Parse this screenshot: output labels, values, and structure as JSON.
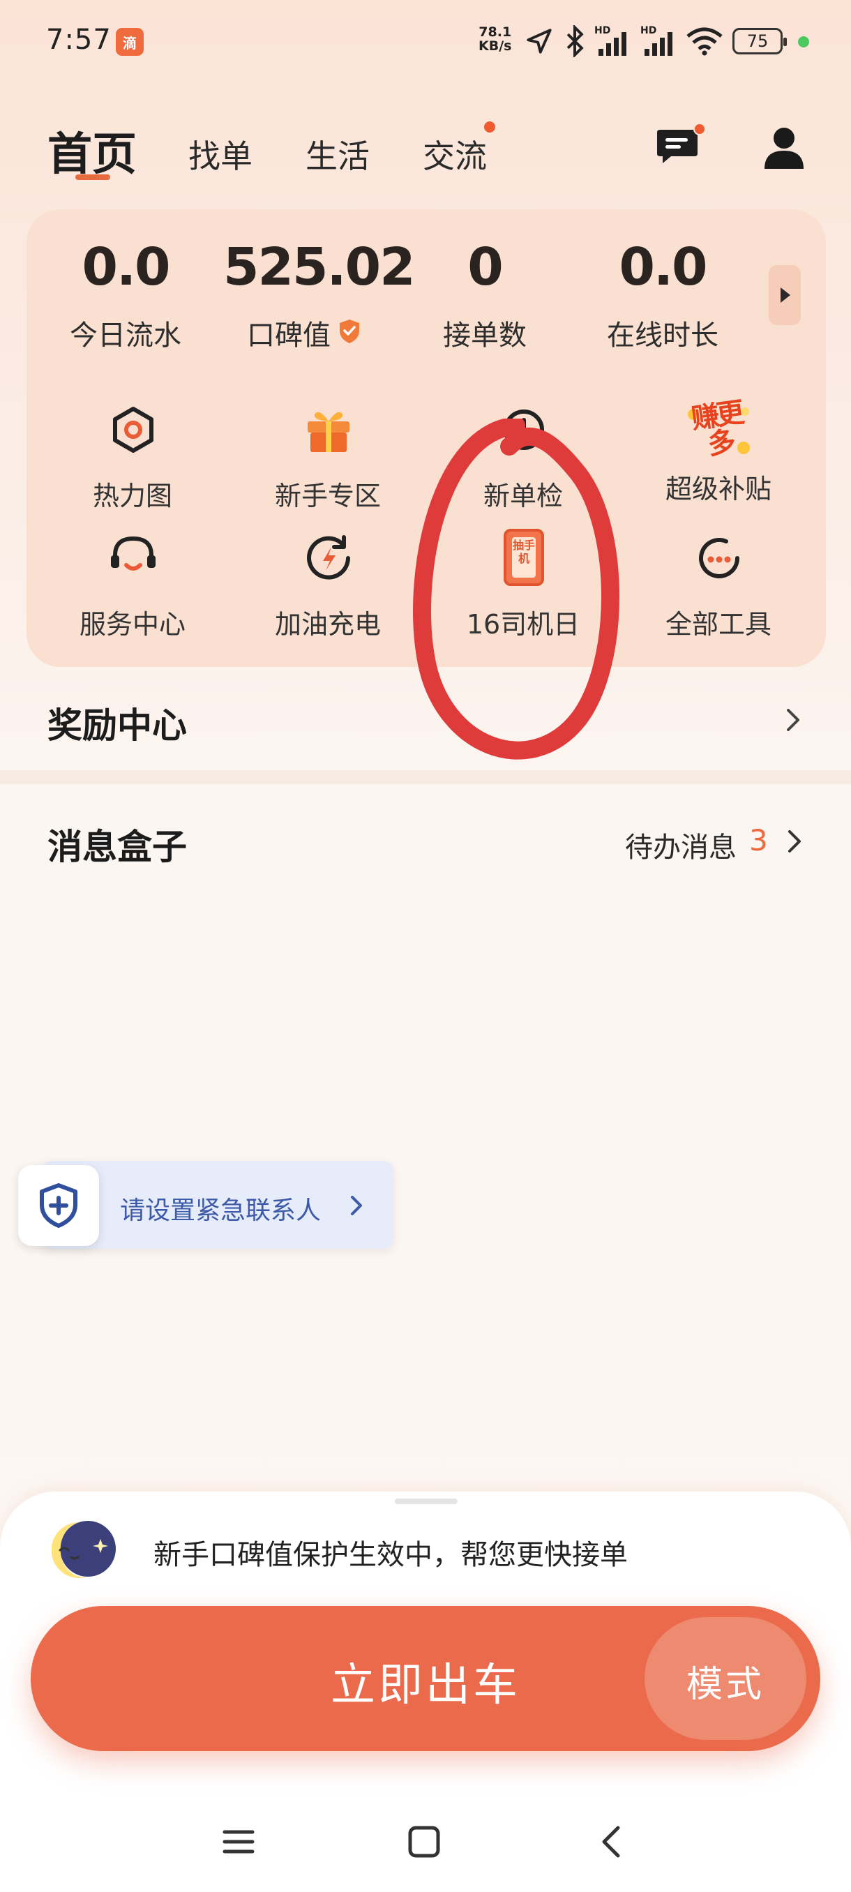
{
  "status_bar": {
    "time": "7:57",
    "app_icon_text": "滴",
    "net_speed_value": "78.1",
    "net_speed_unit": "KB/s",
    "signal_label_1": "HD",
    "signal_label_2": "HD",
    "battery": "75"
  },
  "nav": {
    "tabs": [
      {
        "label": "首页",
        "active": true
      },
      {
        "label": "找单",
        "active": false
      },
      {
        "label": "生活",
        "active": false
      },
      {
        "label": "交流",
        "active": false,
        "has_dot": true
      }
    ]
  },
  "stats": [
    {
      "value": "0.0",
      "label": "今日流水"
    },
    {
      "value": "525.02",
      "label": "口碑值"
    },
    {
      "value": "0",
      "label": "接单数"
    },
    {
      "value": "0.0",
      "label": "在线时长"
    }
  ],
  "tools": [
    {
      "label": "热力图",
      "icon": "heatmap-icon"
    },
    {
      "label": "新手专区",
      "icon": "gift-icon"
    },
    {
      "label": "新单检",
      "icon": "order-check-icon"
    },
    {
      "label": "超级补贴",
      "icon": "earn-more-icon"
    },
    {
      "label": "服务中心",
      "icon": "headset-icon"
    },
    {
      "label": "加油充电",
      "icon": "charge-icon"
    },
    {
      "label": "16司机日",
      "icon": "driver-day-icon"
    },
    {
      "label": "全部工具",
      "icon": "more-icon"
    }
  ],
  "tool_badges": {
    "earn_more": "赚更多",
    "driver_day": "抽手机"
  },
  "rewards": {
    "title": "奖励中心"
  },
  "message_box": {
    "title": "消息盒子",
    "pending_label": "待办消息",
    "pending_count": "3"
  },
  "emergency": {
    "text": "请设置紧急联系人"
  },
  "bottom": {
    "protection_text": "新手口碑值保护生效中，帮您更快接单",
    "depart_label": "立即出车",
    "mode_label": "模式"
  },
  "colors": {
    "accent": "#EA6A4B",
    "badge": "#EE5B31",
    "annotation": "#E03B3B"
  }
}
